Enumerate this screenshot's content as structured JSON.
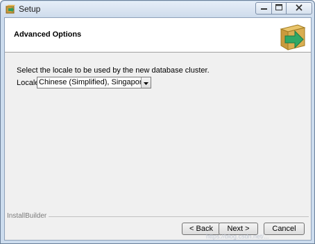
{
  "window": {
    "title": "Setup",
    "controls": {
      "minimize": "minimize",
      "maximize": "maximize",
      "close": "close"
    }
  },
  "header": {
    "title": "Advanced Options",
    "logo_icon": "installer-box-icon"
  },
  "content": {
    "instruction": "Select the locale to be used by the new database cluster.",
    "locale_label": "Locale",
    "locale_selected": "Chinese (Simplified), Singapore"
  },
  "footer": {
    "brand": "InstallBuilder",
    "buttons": {
      "back": "< Back",
      "next": "Next >",
      "cancel": "Cancel"
    }
  },
  "watermark": "https://blog.csdn.net/..."
}
